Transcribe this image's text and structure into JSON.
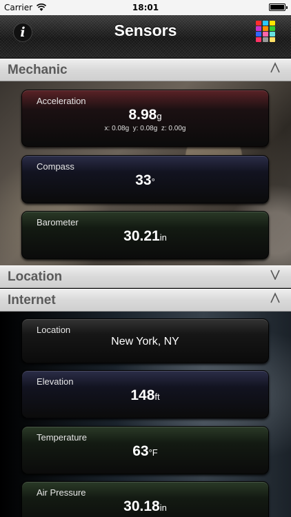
{
  "status": {
    "carrier": "Carrier",
    "time": "18:01"
  },
  "nav": {
    "title": "Sensors",
    "info_icon": "i"
  },
  "colors": {
    "grid": [
      "#ff2d2d",
      "#2ec8ff",
      "#ffe600",
      "#cc33cc",
      "#ff8c00",
      "#33cc33",
      "#3366ff",
      "#ff66aa",
      "#66e0e0",
      "#ff3366",
      "#999999",
      "#ffe066"
    ]
  },
  "sections": {
    "mechanic": {
      "title": "Mechanic",
      "chevron": "^"
    },
    "location": {
      "title": "Location",
      "chevron": "V"
    },
    "internet": {
      "title": "Internet",
      "chevron": "^"
    }
  },
  "mechanic": {
    "acceleration": {
      "label": "Acceleration",
      "value": "8.98",
      "unit": "g",
      "x": "x: 0.08g",
      "y": "y: 0.08g",
      "z": "z: 0.00g"
    },
    "compass": {
      "label": "Compass",
      "value": "33",
      "unit": "°"
    },
    "barometer": {
      "label": "Barometer",
      "value": "30.21",
      "unit": "in"
    }
  },
  "internet": {
    "location": {
      "label": "Location",
      "value": "New York, NY"
    },
    "elevation": {
      "label": "Elevation",
      "value": "148",
      "unit": "ft"
    },
    "temperature": {
      "label": "Temperature",
      "value": "63",
      "unit": "°F"
    },
    "air_pressure": {
      "label": "Air Pressure",
      "value": "30.18",
      "unit": "in"
    }
  }
}
